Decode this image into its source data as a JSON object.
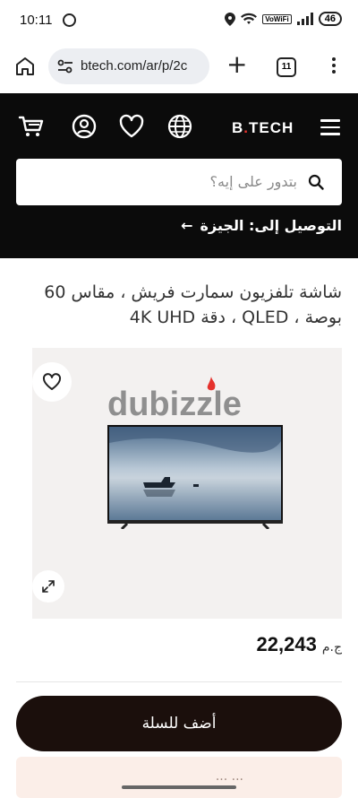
{
  "status_bar": {
    "time": "10:11",
    "network_label": "VoWiFi",
    "battery": "46"
  },
  "browser": {
    "url": "btech.com/ar/p/2c",
    "tab_count": "11",
    "new_tab_symbol": "+"
  },
  "header": {
    "logo_left": "B",
    "logo_dot": ".",
    "logo_right": "TECH",
    "search_placeholder": "بتدور على إيه؟",
    "delivery_text": "التوصيل إلى: الجيزة",
    "delivery_arrow": "←",
    "colors": {
      "background": "#0b0b0b",
      "logo_dot": "#e5322d"
    }
  },
  "product": {
    "title": "شاشة تلفزيون سمارت فريش ، مقاس 60 بوصة ، QLED ، دقة 4K UHD",
    "watermark": "dubizzle",
    "price_value": "22,243",
    "price_currency": "ج.م",
    "add_to_cart": "أضف للسلة",
    "peek_text": "... ...",
    "colors": {
      "cart_button": "#1b0f0c",
      "image_bg": "#f3f1f0"
    }
  },
  "icons": {
    "home": "home-icon",
    "tune": "site-settings-icon",
    "cart": "cart-icon",
    "account": "account-icon",
    "wishlist": "heart-icon",
    "language": "globe-icon",
    "menu": "hamburger-icon",
    "search": "search-icon",
    "expand": "expand-icon"
  }
}
